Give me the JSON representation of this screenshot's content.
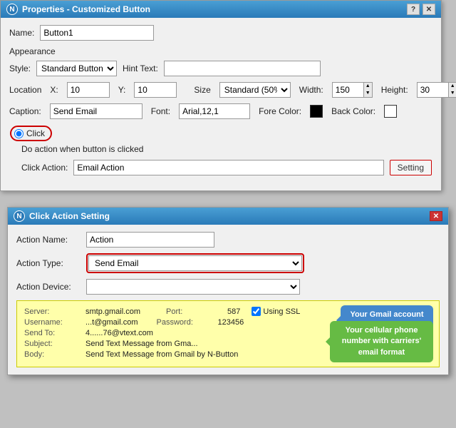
{
  "properties_window": {
    "title": "Properties - Customized Button",
    "title_icon": "N",
    "name_label": "Name:",
    "name_value": "Button1",
    "appearance_label": "Appearance",
    "style_label": "Style:",
    "style_value": "Standard Button",
    "hint_text_label": "Hint Text:",
    "hint_text_value": "",
    "location_label": "Location",
    "x_label": "X:",
    "x_value": "10",
    "y_label": "Y:",
    "y_value": "10",
    "size_label": "Size",
    "size_value": "Standard (50%)",
    "width_label": "Width:",
    "width_value": "150",
    "height_label": "Height:",
    "height_value": "30",
    "caption_label": "Caption:",
    "caption_value": "Send Email",
    "font_label": "Font:",
    "font_value": "Arial,12,1",
    "fore_color_label": "Fore Color:",
    "back_color_label": "Back Color:",
    "click_label": "Click",
    "do_action_label": "Do action when button is clicked",
    "click_action_label": "Click Action:",
    "click_action_value": "Email Action",
    "setting_button_label": "Setting",
    "question_btn": "?",
    "close_btn": "✕"
  },
  "action_window": {
    "title": "Click Action Setting",
    "title_icon": "N",
    "action_name_label": "Action Name:",
    "action_name_value": "Action",
    "action_type_label": "Action Type:",
    "action_type_value": "Send Email",
    "action_device_label": "Action Device:",
    "action_device_value": "",
    "close_btn": "✕",
    "info": {
      "server_label": "Server:",
      "server_value": "smtp.gmail.com",
      "port_label": "Port:",
      "port_value": "587",
      "using_ssl_label": "Using SSL",
      "username_label": "Username:",
      "username_value": "...t@gmail.com",
      "password_label": "Password:",
      "password_value": "123456",
      "send_to_label": "Send To:",
      "send_to_value": "4......76@vtext.com",
      "subject_label": "Subject:",
      "subject_value": "Send Text Message from Gma...",
      "body_label": "Body:",
      "body_value": "Send Text Message from Gmail by N-Button"
    },
    "callout_gmail": "Your Gmail account\nand  password",
    "callout_phone": "Your cellular phone number\nwith carriers' email format"
  }
}
